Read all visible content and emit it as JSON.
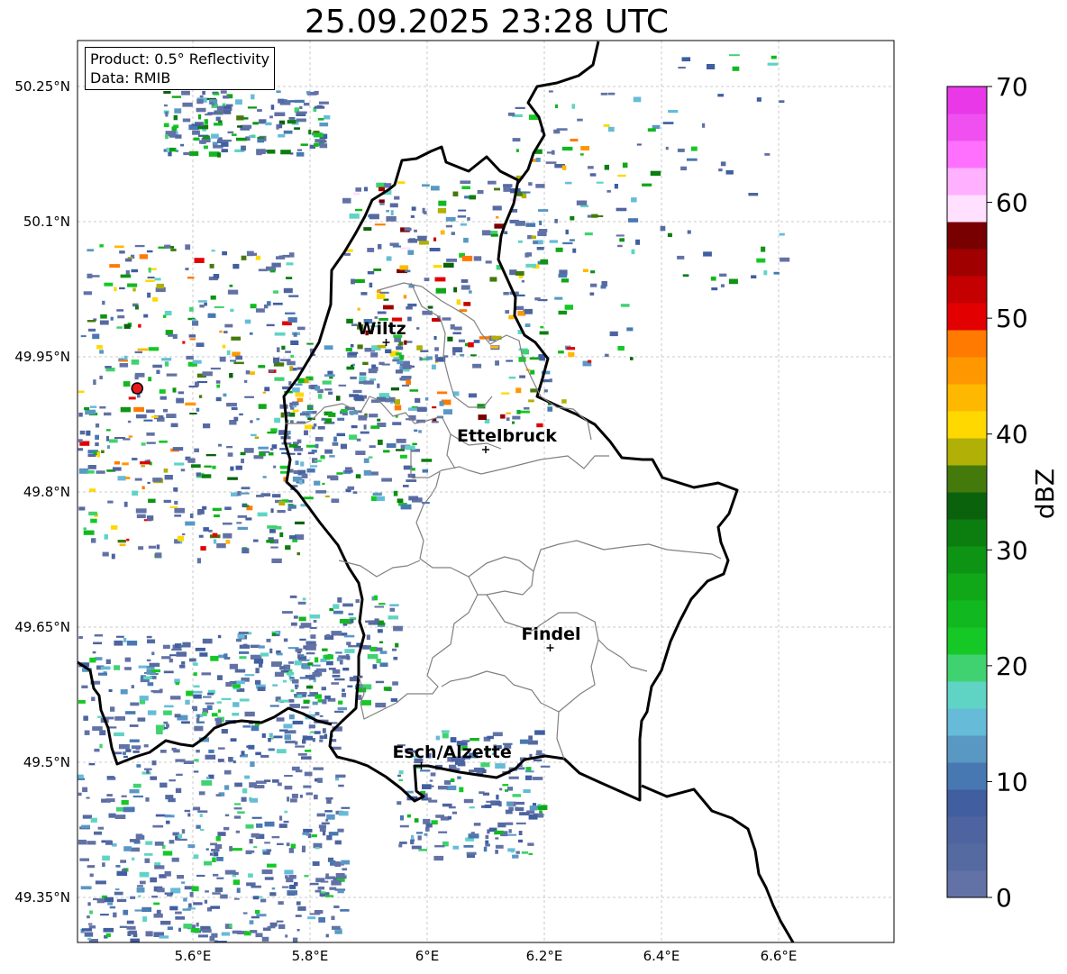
{
  "title": "25.09.2025 23:28 UTC",
  "info": {
    "product": "Product: 0.5° Reflectivity",
    "data_source": "Data: RMIB"
  },
  "axes": {
    "x_ticks": [
      "5.6°E",
      "5.8°E",
      "6°E",
      "6.2°E",
      "6.4°E",
      "6.6°E"
    ],
    "y_ticks": [
      "50.25°N",
      "50.1°N",
      "49.95°N",
      "49.8°N",
      "49.65°N",
      "49.5°N",
      "49.35°N"
    ]
  },
  "cities": [
    {
      "name": "Wiltz",
      "lon": 5.93,
      "lat": 49.966
    },
    {
      "name": "Ettelbruck",
      "lon": 6.1,
      "lat": 49.847
    },
    {
      "name": "Findel",
      "lon": 6.21,
      "lat": 49.627
    },
    {
      "name": "Esch/Alzette",
      "lon": 5.99,
      "lat": 49.496
    }
  ],
  "radar_site": {
    "lon": 5.505,
    "lat": 49.915,
    "color": "#e8191b"
  },
  "colorbar": {
    "label": "dBZ",
    "min": 0,
    "max": 70,
    "ticks": [
      "0",
      "10",
      "20",
      "30",
      "40",
      "50",
      "60",
      "70"
    ],
    "colors": [
      "#6272a6",
      "#566aa2",
      "#4e64a0",
      "#405ea0",
      "#4878b2",
      "#5a98c4",
      "#66bcd8",
      "#60d4c4",
      "#40d270",
      "#16c826",
      "#12b820",
      "#10a818",
      "#0e9414",
      "#0c7e10",
      "#0a620c",
      "#447a0c",
      "#b0b006",
      "#ffd800",
      "#ffb800",
      "#ff9800",
      "#ff7a00",
      "#e20000",
      "#c40000",
      "#a00000",
      "#780000",
      "#ffe0ff",
      "#ffb0ff",
      "#ff70ff",
      "#f050f0",
      "#e838e8"
    ]
  },
  "colors": {
    "border": "#000000",
    "canton_lines": "#808080",
    "grid": "#bbbbbb",
    "precip_light": "#4e64a0",
    "precip_mid": "#66bcd8",
    "precip_strong": "#12b820"
  }
}
